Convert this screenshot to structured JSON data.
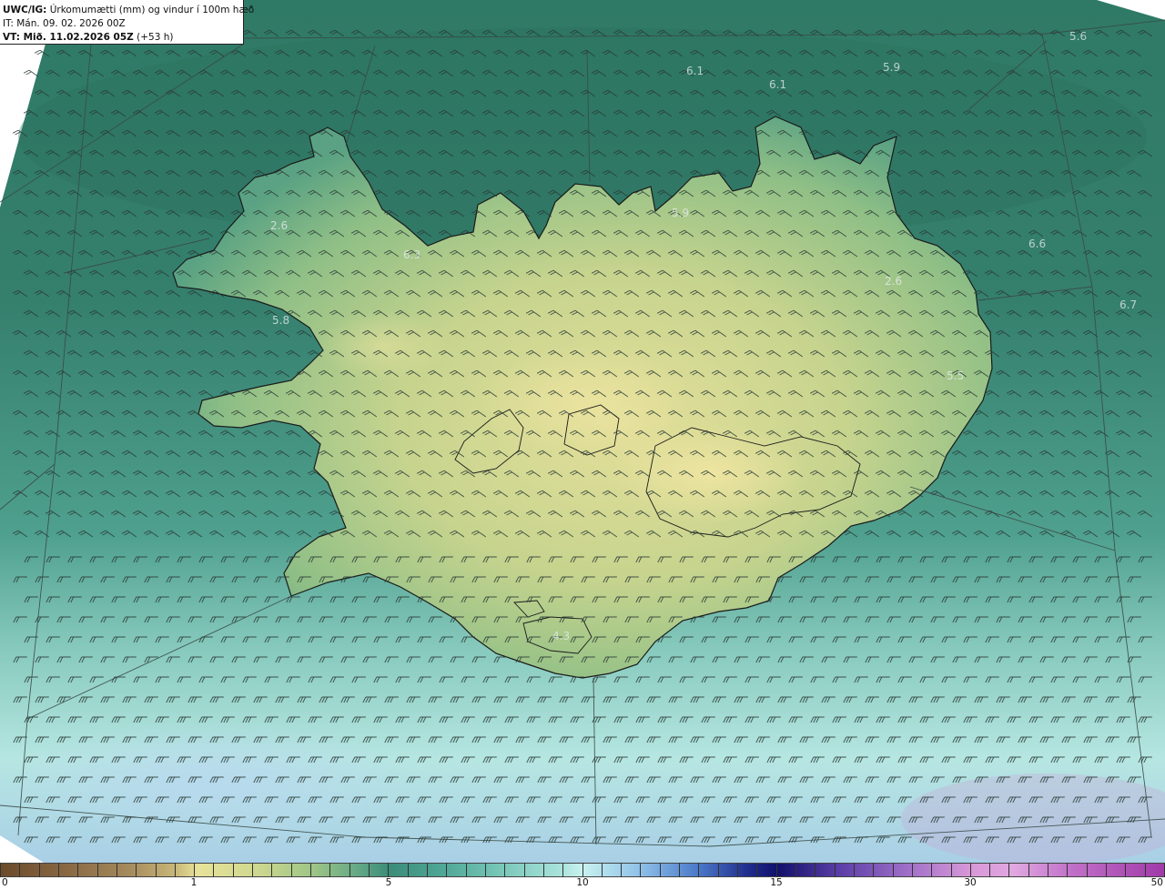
{
  "header": {
    "model": "UWC/IG:",
    "title": "Úrkomumætti (mm) og vindur í 100m hæð",
    "init_time": "IT: Mán. 09. 02. 2026 00Z",
    "valid_prefix": "VT: Mið. 11.02.2026 05Z",
    "valid_offset": "(+53 h)"
  },
  "map_labels": [
    "5.6",
    "6.1",
    "6.1",
    "5.9",
    "5.9",
    "2.6",
    "6.3",
    "6.6",
    "2.6",
    "6.7",
    "5.8",
    "5.5",
    "4.3"
  ],
  "colorbar": {
    "ticks": [
      "0",
      "1",
      "5",
      "10",
      "15",
      "30",
      "50"
    ],
    "units": "mm"
  },
  "colors": {
    "land_high": "#e8e29a",
    "land_low": "#5fa685",
    "sea_north": "#2f7a66",
    "sea_south": "#a8e2da",
    "coastline": "#1a1a1a",
    "wind_barb": "#2a3a36"
  },
  "wind": {
    "north_region_direction": "southwest",
    "south_region_direction": "west"
  }
}
